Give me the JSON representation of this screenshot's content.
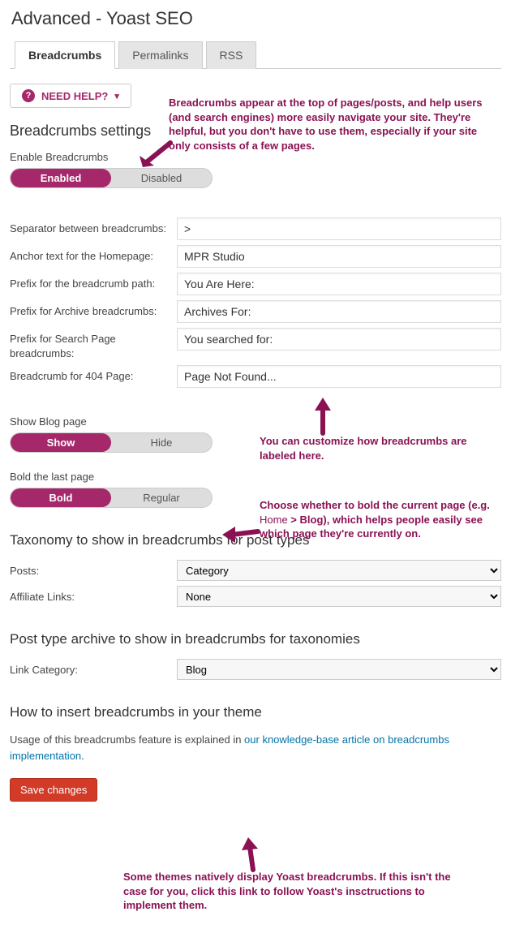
{
  "page_title": "Advanced - Yoast SEO",
  "tabs": {
    "breadcrumbs": "Breadcrumbs",
    "permalinks": "Permalinks",
    "rss": "RSS"
  },
  "help_button": "NEED HELP?",
  "sections": {
    "settings_heading": "Breadcrumbs settings",
    "enable_label": "Enable Breadcrumbs",
    "enable": {
      "on": "Enabled",
      "off": "Disabled"
    },
    "fields": {
      "separator": {
        "label": "Separator between breadcrumbs:",
        "value": ">"
      },
      "anchor": {
        "label": "Anchor text for the Homepage:",
        "value": "MPR Studio"
      },
      "prefix_path": {
        "label": "Prefix for the breadcrumb path:",
        "value": "You Are Here:"
      },
      "prefix_archive": {
        "label": "Prefix for Archive breadcrumbs:",
        "value": "Archives For:"
      },
      "prefix_search": {
        "label": "Prefix for Search Page breadcrumbs:",
        "value": "You searched for:"
      },
      "page_404": {
        "label": "Breadcrumb for 404 Page:",
        "value": "Page Not Found..."
      }
    },
    "show_blog": {
      "label": "Show Blog page",
      "on": "Show",
      "off": "Hide"
    },
    "bold_last": {
      "label": "Bold the last page",
      "on": "Bold",
      "off": "Regular"
    },
    "taxonomy_heading": "Taxonomy to show in breadcrumbs for post types",
    "taxonomy": {
      "posts": {
        "label": "Posts:",
        "value": "Category"
      },
      "affiliate": {
        "label": "Affiliate Links:",
        "value": "None"
      }
    },
    "archive_heading": "Post type archive to show in breadcrumbs for taxonomies",
    "archive": {
      "link_category": {
        "label": "Link Category:",
        "value": "Blog"
      }
    },
    "insert_heading": "How to insert breadcrumbs in your theme",
    "insert_text_pre": "Usage of this breadcrumbs feature is explained in ",
    "insert_link": "our knowledge-base article on breadcrumbs implementation",
    "insert_text_post": "."
  },
  "save_button": "Save changes",
  "annotations": {
    "top": "Breadcrumbs appear at the top of pages/posts, and help users (and search engines) more easily navigate your site. They're helpful, but you don't have to use them, especially if your site only consists of a few pages.",
    "labels": "You can customize how breadcrumbs are labeled here.",
    "bold_pre": "Choose whether to bold the current page (e.g. ",
    "bold_home": "Home",
    "bold_sep": " > ",
    "bold_blog": "Blog",
    "bold_post": "), which helps people easily see which page they're currently on.",
    "bottom": "Some themes natively display Yoast breadcrumbs. If this isn't the case for you, click this link to follow Yoast's insctructions to implement them."
  }
}
